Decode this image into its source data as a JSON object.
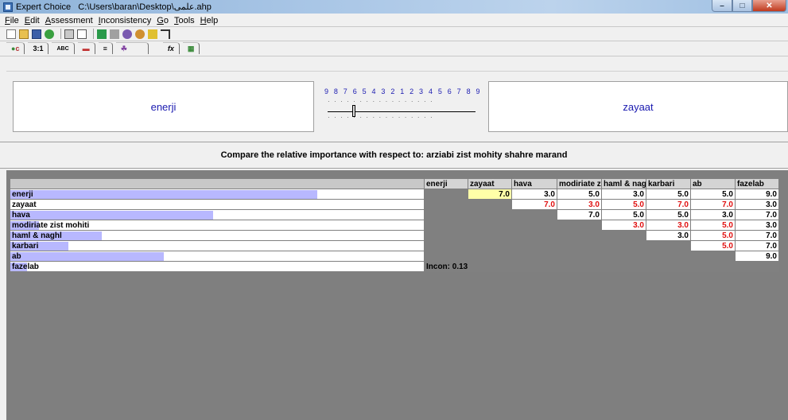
{
  "window": {
    "app": "Expert Choice",
    "path": "C:\\Users\\baran\\Desktop\\علمی.ahp"
  },
  "menu": [
    "File",
    "Edit",
    "Assessment",
    "Inconsistency",
    "Go",
    "Tools",
    "Help"
  ],
  "toolbar2": {
    "tab_ratio": "3:1",
    "tab_abc": "ABC",
    "tab_fx": "fx"
  },
  "comparison": {
    "left": "enerji",
    "right": "zayaat",
    "scale_numbers": "9 8 7 6 5 4 3 2 1 2 3 4 5 6 7 8 9",
    "caption": "Compare the relative importance with respect to: arziabi zist mohity shahre marand",
    "selected_value": 7.0
  },
  "matrix": {
    "columns": [
      "enerji",
      "zayaat",
      "hava",
      "modiriate z",
      "haml & nag",
      "karbari",
      "ab",
      "fazelab"
    ],
    "rows": [
      {
        "label": "enerji",
        "bar": 0.74,
        "cells": [
          "",
          "7.0",
          "3.0",
          "5.0",
          "3.0",
          "5.0",
          "5.0",
          "9.0"
        ],
        "red": [
          false,
          false,
          false,
          false,
          false,
          false,
          false,
          false
        ]
      },
      {
        "label": "zayaat",
        "bar": 0.0,
        "cells": [
          "",
          "",
          "7.0",
          "3.0",
          "5.0",
          "7.0",
          "7.0",
          "3.0"
        ],
        "red": [
          false,
          false,
          true,
          true,
          true,
          true,
          true,
          false
        ]
      },
      {
        "label": "hava",
        "bar": 0.49,
        "cells": [
          "",
          "",
          "",
          "7.0",
          "5.0",
          "5.0",
          "3.0",
          "7.0"
        ],
        "red": [
          false,
          false,
          false,
          false,
          false,
          false,
          false,
          false
        ]
      },
      {
        "label": "modiriate zist mohiti",
        "bar": 0.07,
        "cells": [
          "",
          "",
          "",
          "",
          "3.0",
          "3.0",
          "5.0",
          "3.0"
        ],
        "red": [
          false,
          false,
          false,
          false,
          true,
          true,
          true,
          false
        ]
      },
      {
        "label": "haml & naghl",
        "bar": 0.22,
        "cells": [
          "",
          "",
          "",
          "",
          "",
          "3.0",
          "5.0",
          "7.0"
        ],
        "red": [
          false,
          false,
          false,
          false,
          false,
          false,
          true,
          false
        ]
      },
      {
        "label": "karbari",
        "bar": 0.14,
        "cells": [
          "",
          "",
          "",
          "",
          "",
          "",
          "5.0",
          "7.0"
        ],
        "red": [
          false,
          false,
          false,
          false,
          false,
          false,
          true,
          false
        ]
      },
      {
        "label": "ab",
        "bar": 0.37,
        "cells": [
          "",
          "",
          "",
          "",
          "",
          "",
          "",
          "9.0"
        ],
        "red": [
          false,
          false,
          false,
          false,
          false,
          false,
          false,
          false
        ]
      },
      {
        "label": "fazelab",
        "bar": 0.04,
        "cells": [
          "",
          "",
          "",
          "",
          "",
          "",
          "",
          ""
        ],
        "red": [
          false,
          false,
          false,
          false,
          false,
          false,
          false,
          false
        ]
      }
    ],
    "inconsistency": "Incon: 0.13"
  }
}
